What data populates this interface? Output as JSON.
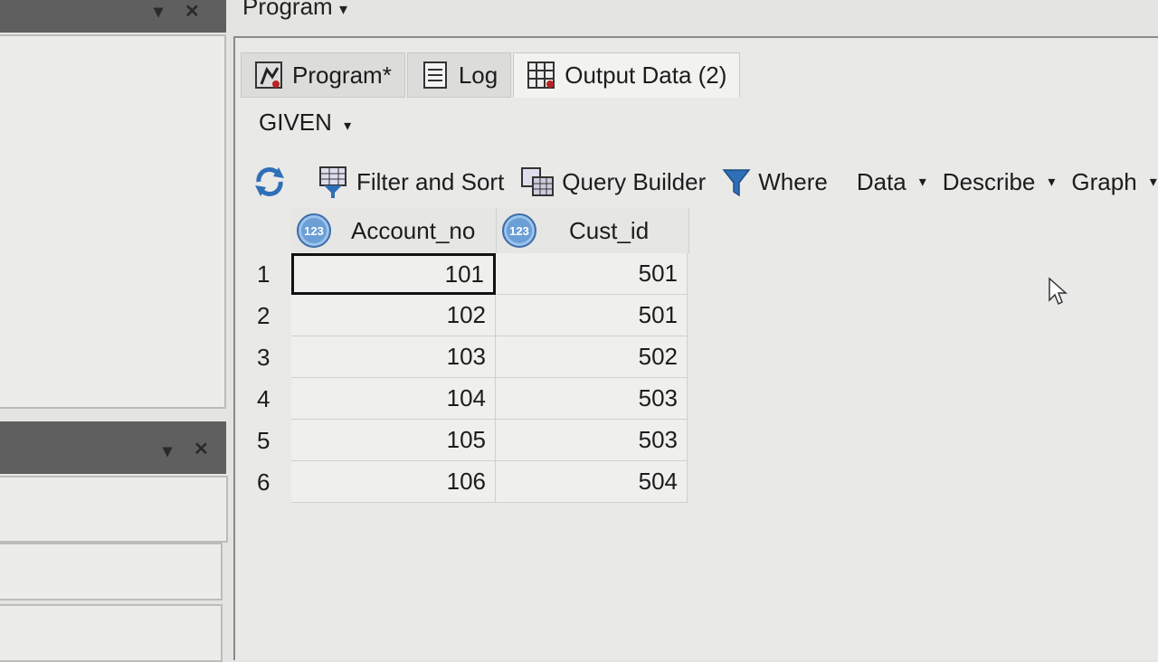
{
  "top_panel": {
    "title": "Program"
  },
  "tabs": [
    {
      "label": "Program*",
      "icon": "program-run-icon"
    },
    {
      "label": "Log",
      "icon": "log-document-icon"
    },
    {
      "label": "Output Data (2)",
      "icon": "output-table-icon"
    }
  ],
  "dataset": {
    "name": "GIVEN"
  },
  "toolbar": {
    "filter_sort": "Filter and Sort",
    "query_builder": "Query Builder",
    "where": "Where",
    "data": "Data",
    "describe": "Describe",
    "graph": "Graph"
  },
  "table": {
    "columns": [
      {
        "name": "Account_no",
        "type_icon": "123"
      },
      {
        "name": "Cust_id",
        "type_icon": "123"
      }
    ],
    "rows": [
      {
        "n": "1",
        "account_no": "101",
        "cust_id": "501"
      },
      {
        "n": "2",
        "account_no": "102",
        "cust_id": "501"
      },
      {
        "n": "3",
        "account_no": "103",
        "cust_id": "502"
      },
      {
        "n": "4",
        "account_no": "104",
        "cust_id": "503"
      },
      {
        "n": "5",
        "account_no": "105",
        "cust_id": "503"
      },
      {
        "n": "6",
        "account_no": "106",
        "cust_id": "504"
      }
    ]
  },
  "colors": {
    "pane_header": "#5f5f5f",
    "accent_icon": "#6b9fd6"
  }
}
